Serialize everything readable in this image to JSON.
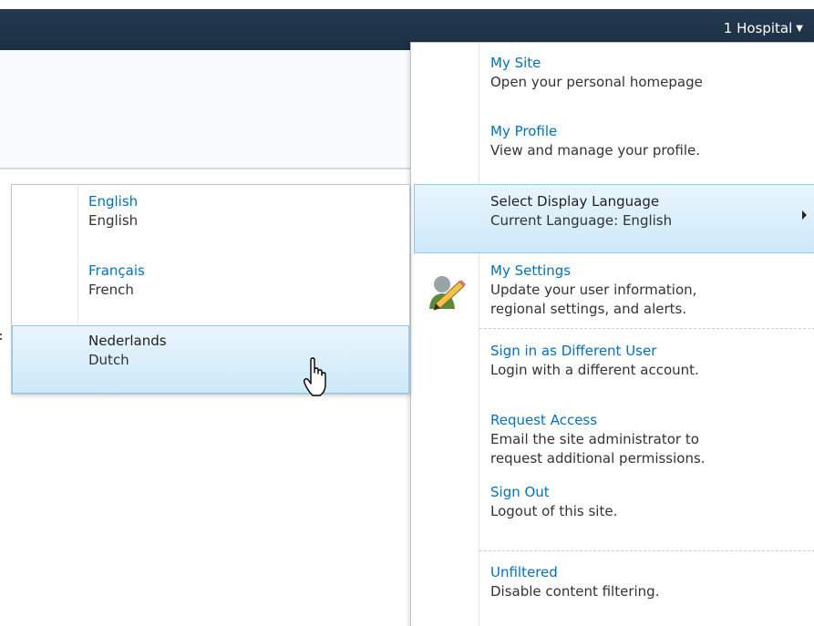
{
  "header": {
    "user_name": "1 Hospital",
    "caret_icon": "caret-down-icon"
  },
  "user_menu": {
    "items": [
      {
        "title": "My Site",
        "desc": [
          "Open your personal homepage"
        ]
      },
      {
        "title": "My Profile",
        "desc": [
          "View and manage your profile."
        ]
      },
      {
        "title": "Select Display Language",
        "desc": [
          "Current Language: English"
        ],
        "has_submenu": true,
        "selected": true
      },
      {
        "title": "My Settings",
        "desc": [
          "Update your user information,",
          "regional settings, and alerts."
        ],
        "icon": "user-settings-icon"
      },
      {
        "title": "Sign in as Different User",
        "desc": [
          "Login with a different account."
        ]
      },
      {
        "title": "Request Access",
        "desc": [
          "Email the site administrator to",
          "request additional permissions."
        ]
      },
      {
        "title": "Sign Out",
        "desc": [
          "Logout of this site."
        ]
      },
      {
        "title": "Unfiltered",
        "desc": [
          "Disable content filtering."
        ]
      }
    ]
  },
  "language_submenu": {
    "items": [
      {
        "title": "English",
        "desc": "English"
      },
      {
        "title": "Français",
        "desc": "French"
      },
      {
        "title": "Nederlands",
        "desc": "Dutch",
        "hovered": true
      }
    ]
  },
  "colors": {
    "topbar": "#1b2f44",
    "link": "#0072bc",
    "highlight": "#cde9fa",
    "highlight_border": "#92c7ee"
  }
}
